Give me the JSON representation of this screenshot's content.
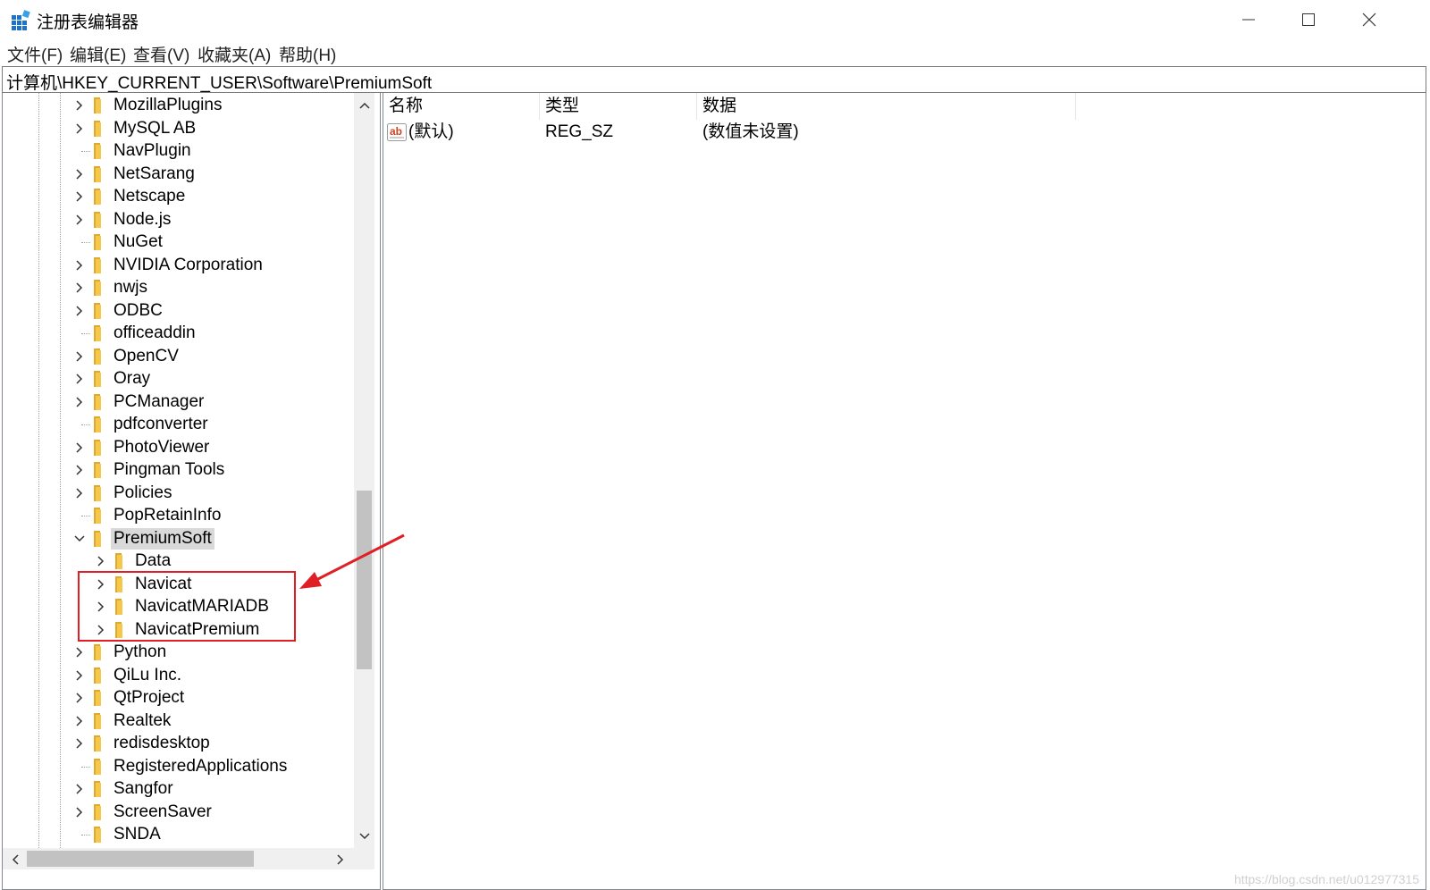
{
  "window": {
    "title": "注册表编辑器",
    "icon": "regedit-icon",
    "controls": {
      "minimize": "minimize-icon",
      "maximize": "maximize-icon",
      "close": "close-icon"
    }
  },
  "menu": [
    {
      "label": "文件(F)"
    },
    {
      "label": "编辑(E)"
    },
    {
      "label": "查看(V)"
    },
    {
      "label": "收藏夹(A)"
    },
    {
      "label": "帮助(H)"
    }
  ],
  "address": {
    "path": "计算机\\HKEY_CURRENT_USER\\Software\\PremiumSoft"
  },
  "tree": {
    "selected": "PremiumSoft",
    "items": [
      {
        "label": "MozillaPlugins",
        "level": 1,
        "expander": "collapsed"
      },
      {
        "label": "MySQL AB",
        "level": 1,
        "expander": "collapsed"
      },
      {
        "label": "NavPlugin",
        "level": 1,
        "expander": "none"
      },
      {
        "label": "NetSarang",
        "level": 1,
        "expander": "collapsed"
      },
      {
        "label": "Netscape",
        "level": 1,
        "expander": "collapsed"
      },
      {
        "label": "Node.js",
        "level": 1,
        "expander": "collapsed"
      },
      {
        "label": "NuGet",
        "level": 1,
        "expander": "none"
      },
      {
        "label": "NVIDIA Corporation",
        "level": 1,
        "expander": "collapsed"
      },
      {
        "label": "nwjs",
        "level": 1,
        "expander": "collapsed"
      },
      {
        "label": "ODBC",
        "level": 1,
        "expander": "collapsed"
      },
      {
        "label": "officeaddin",
        "level": 1,
        "expander": "none"
      },
      {
        "label": "OpenCV",
        "level": 1,
        "expander": "collapsed"
      },
      {
        "label": "Oray",
        "level": 1,
        "expander": "collapsed"
      },
      {
        "label": "PCManager",
        "level": 1,
        "expander": "collapsed"
      },
      {
        "label": "pdfconverter",
        "level": 1,
        "expander": "none"
      },
      {
        "label": "PhotoViewer",
        "level": 1,
        "expander": "collapsed"
      },
      {
        "label": "Pingman Tools",
        "level": 1,
        "expander": "collapsed"
      },
      {
        "label": "Policies",
        "level": 1,
        "expander": "collapsed"
      },
      {
        "label": "PopRetainInfo",
        "level": 1,
        "expander": "none"
      },
      {
        "label": "PremiumSoft",
        "level": 1,
        "expander": "expanded"
      },
      {
        "label": "Data",
        "level": 2,
        "expander": "collapsed"
      },
      {
        "label": "Navicat",
        "level": 2,
        "expander": "collapsed"
      },
      {
        "label": "NavicatMARIADB",
        "level": 2,
        "expander": "collapsed"
      },
      {
        "label": "NavicatPremium",
        "level": 2,
        "expander": "collapsed"
      },
      {
        "label": "Python",
        "level": 1,
        "expander": "collapsed"
      },
      {
        "label": "QiLu Inc.",
        "level": 1,
        "expander": "collapsed"
      },
      {
        "label": "QtProject",
        "level": 1,
        "expander": "collapsed"
      },
      {
        "label": "Realtek",
        "level": 1,
        "expander": "collapsed"
      },
      {
        "label": "redisdesktop",
        "level": 1,
        "expander": "collapsed"
      },
      {
        "label": "RegisteredApplications",
        "level": 1,
        "expander": "none"
      },
      {
        "label": "Sangfor",
        "level": 1,
        "expander": "collapsed"
      },
      {
        "label": "ScreenSaver",
        "level": 1,
        "expander": "collapsed"
      },
      {
        "label": "SNDA",
        "level": 1,
        "expander": "none"
      }
    ]
  },
  "values": {
    "columns": [
      "名称",
      "类型",
      "数据"
    ],
    "rows": [
      {
        "name": "(默认)",
        "type": "REG_SZ",
        "data": "(数值未设置)",
        "icon": "string-value-icon"
      }
    ]
  },
  "annotation": {
    "color": "#e01e26",
    "highlighted_items": [
      "Navicat",
      "NavicatMARIADB",
      "NavicatPremium"
    ]
  },
  "watermark": "https://blog.csdn.net/u012977315"
}
